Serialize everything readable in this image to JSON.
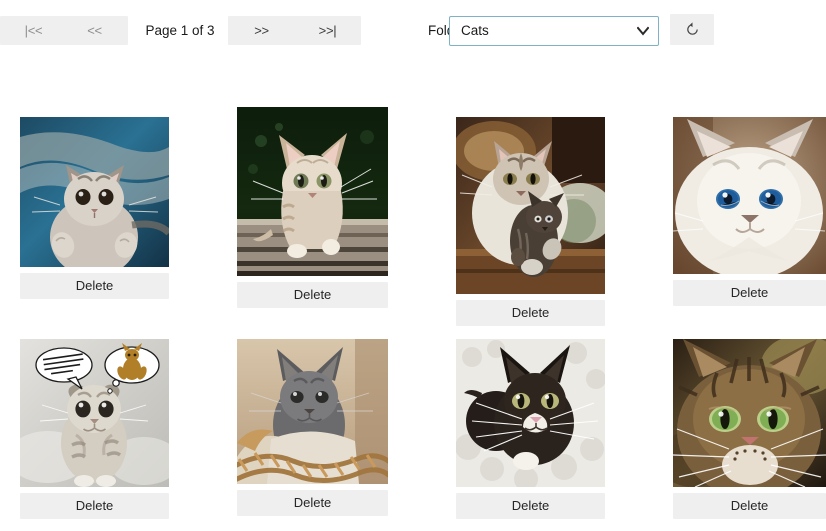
{
  "toolbar": {
    "first_label": "|<<",
    "prev_label": "<<",
    "next_label": ">>",
    "last_label": ">>|",
    "page_indicator": "Page 1 of 3",
    "folder_label": "Folder:",
    "folder_selected": "Cats",
    "folder_options": [
      "Cats"
    ],
    "refresh_icon": "refresh-icon",
    "select_arrow_icon": "chevron-down-icon",
    "select_border_color": "#7fb2c4",
    "button_bg_color": "#efefef",
    "disabled_text_color": "#8d8d8d",
    "enabled_text_color": "#3a3a3a"
  },
  "gallery": {
    "delete_label": "Delete",
    "items": [
      {
        "alt": "tabby kitten lying on blue blanket",
        "delete_label": "Delete"
      },
      {
        "alt": "kitten sitting on wooden deck",
        "delete_label": "Delete"
      },
      {
        "alt": "mother cat carrying kitten in mouth",
        "delete_label": "Delete"
      },
      {
        "alt": "white ragdoll kitten with blue eyes",
        "delete_label": "Delete"
      },
      {
        "alt": "scottish fold kitten meme with speech bubbles",
        "delete_label": "Delete"
      },
      {
        "alt": "grey kitten in wicker basket",
        "delete_label": "Delete"
      },
      {
        "alt": "black and white tuxedo kitten on white blanket",
        "delete_label": "Delete"
      },
      {
        "alt": "brown tabby cat close-up with green eyes",
        "delete_label": "Delete"
      }
    ]
  }
}
